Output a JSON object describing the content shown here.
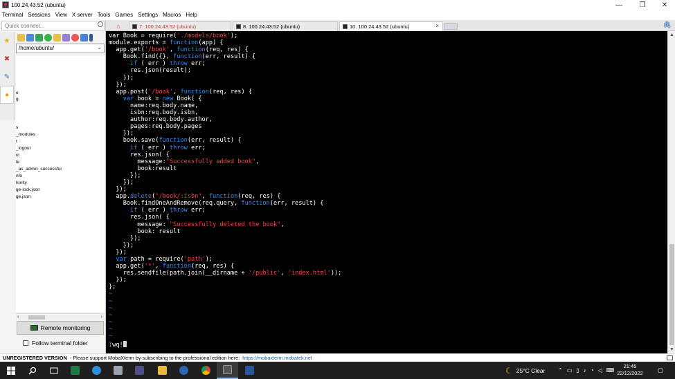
{
  "window": {
    "title": "100.24.43.52 (ubuntu)"
  },
  "window_controls": {
    "minimize": "—",
    "maximize": "❐",
    "close": "✕"
  },
  "menu": [
    "Terminal",
    "Sessions",
    "View",
    "X server",
    "Tools",
    "Games",
    "Settings",
    "Macros",
    "Help"
  ],
  "sidebar": {
    "quick_connect_placeholder": "Quick connect...",
    "path": "/home/ubuntu/",
    "files": [
      "e",
      "g",
      "s",
      "_modules",
      "t",
      "_logout",
      "rc",
      "le",
      "_as_admin_successful",
      "nfo",
      "hority",
      "ge-lock.json",
      "ge.json"
    ],
    "remote_monitoring": "Remote monitoring",
    "follow_terminal_folder": "Follow terminal folder"
  },
  "tabs": [
    {
      "label": "7. 100.24.43.52 (ubuntu)",
      "active": false,
      "highlight": true
    },
    {
      "label": "8. 100.24.43.52 (ubuntu)",
      "active": false,
      "highlight": false
    },
    {
      "label": "10. 100.24.43.52 (ubuntu)",
      "active": true,
      "highlight": false
    }
  ],
  "terminal": {
    "lines": [
      [
        [
          "t",
          "var Book = require("
        ],
        [
          "s",
          "'./models/book'"
        ],
        [
          "t",
          ");"
        ]
      ],
      [
        [
          "t",
          "module.exports = "
        ],
        [
          "k",
          "function"
        ],
        [
          "t",
          "(app) {"
        ]
      ],
      [
        [
          "t",
          "  app.get("
        ],
        [
          "s",
          "'/book'"
        ],
        [
          "t",
          ", "
        ],
        [
          "k",
          "function"
        ],
        [
          "t",
          "(req, res) {"
        ]
      ],
      [
        [
          "t",
          "    Book.find({}, "
        ],
        [
          "k",
          "function"
        ],
        [
          "t",
          "(err, result) {"
        ]
      ],
      [
        [
          "t",
          "      "
        ],
        [
          "k",
          "if"
        ],
        [
          "t",
          " ( err ) "
        ],
        [
          "k",
          "throw"
        ],
        [
          "t",
          " err;"
        ]
      ],
      [
        [
          "t",
          "      res.json(result);"
        ]
      ],
      [
        [
          "t",
          "    });"
        ]
      ],
      [
        [
          "t",
          "  });"
        ]
      ],
      [
        [
          "t",
          "  app.post("
        ],
        [
          "s",
          "'/book'"
        ],
        [
          "t",
          ", "
        ],
        [
          "k",
          "function"
        ],
        [
          "t",
          "(req, res) {"
        ]
      ],
      [
        [
          "t",
          "    "
        ],
        [
          "k",
          "var"
        ],
        [
          "t",
          " book = "
        ],
        [
          "k",
          "new"
        ],
        [
          "t",
          " Book( {"
        ]
      ],
      [
        [
          "t",
          "      name:req.body.name,"
        ]
      ],
      [
        [
          "t",
          "      isbn:req.body.isbn,"
        ]
      ],
      [
        [
          "t",
          "      author:req.body.author,"
        ]
      ],
      [
        [
          "t",
          "      pages:req.body.pages"
        ]
      ],
      [
        [
          "t",
          "    });"
        ]
      ],
      [
        [
          "t",
          "    book.save("
        ],
        [
          "k",
          "function"
        ],
        [
          "t",
          "(err, result) {"
        ]
      ],
      [
        [
          "t",
          "      "
        ],
        [
          "k",
          "if"
        ],
        [
          "t",
          " ( err ) "
        ],
        [
          "k",
          "throw"
        ],
        [
          "t",
          " err;"
        ]
      ],
      [
        [
          "t",
          "      res.json( {"
        ]
      ],
      [
        [
          "t",
          "        message:"
        ],
        [
          "s",
          "\"Successfully added book\""
        ],
        [
          "t",
          ","
        ]
      ],
      [
        [
          "t",
          "        book:result"
        ]
      ],
      [
        [
          "t",
          "      });"
        ]
      ],
      [
        [
          "t",
          "    });"
        ]
      ],
      [
        [
          "t",
          "  });"
        ]
      ],
      [
        [
          "t",
          "  app."
        ],
        [
          "k",
          "delete"
        ],
        [
          "t",
          "("
        ],
        [
          "s",
          "\"/book/:isbn\""
        ],
        [
          "t",
          ", "
        ],
        [
          "k",
          "function"
        ],
        [
          "t",
          "(req, res) {"
        ]
      ],
      [
        [
          "t",
          "    Book.findOneAndRemove(req.query, "
        ],
        [
          "k",
          "function"
        ],
        [
          "t",
          "(err, result) {"
        ]
      ],
      [
        [
          "t",
          "      "
        ],
        [
          "k",
          "if"
        ],
        [
          "t",
          " ( err ) "
        ],
        [
          "k",
          "throw"
        ],
        [
          "t",
          " err;"
        ]
      ],
      [
        [
          "t",
          "      res.json( {"
        ]
      ],
      [
        [
          "t",
          "        message: "
        ],
        [
          "s",
          "\"Successfully deleted the book\""
        ],
        [
          "t",
          ","
        ]
      ],
      [
        [
          "t",
          "        book: result"
        ]
      ],
      [
        [
          "t",
          "      });"
        ]
      ],
      [
        [
          "t",
          "    });"
        ]
      ],
      [
        [
          "t",
          "  });"
        ]
      ],
      [
        [
          "t",
          "  "
        ],
        [
          "k",
          "var"
        ],
        [
          "t",
          " path = require("
        ],
        [
          "s",
          "'path'"
        ],
        [
          "t",
          ");"
        ]
      ],
      [
        [
          "t",
          "  app.get("
        ],
        [
          "s",
          "'*'"
        ],
        [
          "t",
          ", "
        ],
        [
          "k",
          "function"
        ],
        [
          "t",
          "(req, res) {"
        ]
      ],
      [
        [
          "t",
          "    res.sendfile(path.join(__dirname + "
        ],
        [
          "s",
          "'/public'"
        ],
        [
          "t",
          ", "
        ],
        [
          "s",
          "'index.html'"
        ],
        [
          "t",
          "));"
        ]
      ],
      [
        [
          "t",
          "  });"
        ]
      ],
      [
        [
          "t",
          "};"
        ]
      ],
      [
        [
          "~",
          "~"
        ]
      ],
      [
        [
          "~",
          "~"
        ]
      ],
      [
        [
          "~",
          "~"
        ]
      ],
      [
        [
          "~",
          "~"
        ]
      ],
      [
        [
          "~",
          "~"
        ]
      ],
      [
        [
          "~",
          "~"
        ]
      ],
      [
        [
          "~",
          "~"
        ]
      ],
      [
        [
          "~",
          "~"
        ]
      ]
    ],
    "command": ":wq!"
  },
  "status": {
    "label": "UNREGISTERED VERSION",
    "message": " -  Please support MobaXterm by subscribing to the professional edition here:",
    "link": "https://mobaxterm.mobatek.net"
  },
  "taskbar": {
    "weather": "25°C  Clear",
    "time": "21:45",
    "date": "22/12/2022"
  },
  "colors": {
    "keyword": "#1e90ff",
    "string": "#ff3b3b",
    "terminal_bg": "#000000",
    "taskbar_bg": "#1f1f1f"
  }
}
